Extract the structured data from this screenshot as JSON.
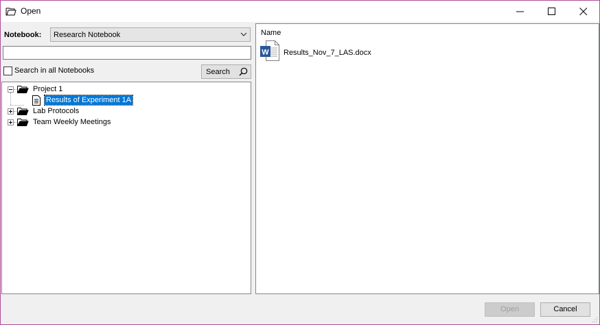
{
  "window": {
    "title": "Open"
  },
  "notebook": {
    "label": "Notebook:",
    "selected": "Research Notebook"
  },
  "search": {
    "value": "",
    "checkbox_label": "Search in all Notebooks",
    "checked": false,
    "button_label": "Search"
  },
  "tree": {
    "items": [
      {
        "label": "Project 1",
        "type": "folder",
        "expanded": true
      },
      {
        "label": "Results of Experiment 1A",
        "type": "page",
        "selected": true
      },
      {
        "label": "Lab Protocols",
        "type": "folder",
        "expanded": false
      },
      {
        "label": "Team Weekly Meetings",
        "type": "folder",
        "expanded": false
      }
    ]
  },
  "files": {
    "header": "Name",
    "items": [
      {
        "name": "Results_Nov_7_LAS.docx",
        "icon": "word-document-icon"
      }
    ]
  },
  "buttons": {
    "open_label": "Open",
    "cancel_label": "Cancel"
  },
  "colors": {
    "selection": "#0078d7",
    "window_border": "#b04a9d",
    "word_blue": "#2b579a"
  }
}
